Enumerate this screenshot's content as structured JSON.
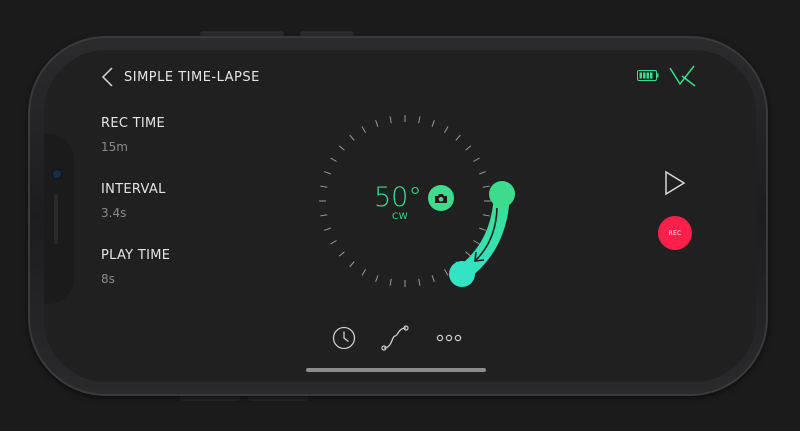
{
  "header": {
    "title": "SIMPLE TIME-LAPSE"
  },
  "params": [
    {
      "label": "REC TIME",
      "value": "15m"
    },
    {
      "label": "INTERVAL",
      "value": "3.4s"
    },
    {
      "label": "PLAY TIME",
      "value": "8s"
    }
  ],
  "dial": {
    "angle": "50°",
    "direction": "CW"
  },
  "controls": {
    "rec_label": "REC"
  },
  "bottom_nav": {
    "icons": [
      "clock-icon",
      "curve-icon",
      "more-icon"
    ]
  },
  "colors": {
    "accent": "#3ddc8d",
    "record": "#ff1f4b",
    "background": "#202021",
    "text": "#e4e4e4",
    "muted": "#8a8a8a"
  }
}
